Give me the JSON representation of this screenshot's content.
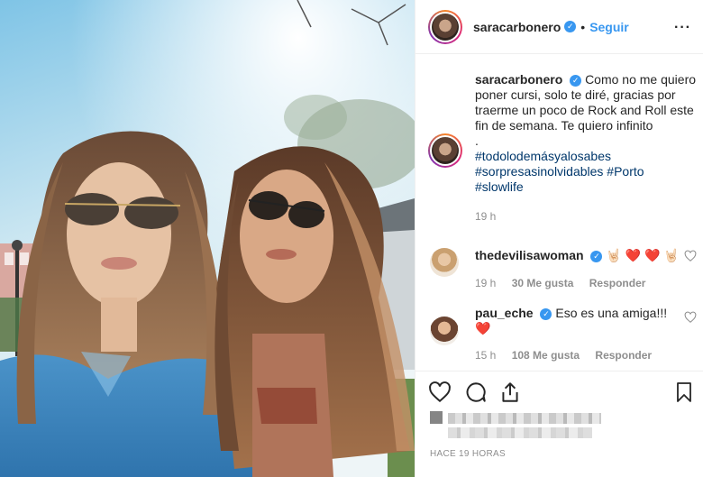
{
  "post": {
    "username": "saracarbonero",
    "follow_label": "Seguir",
    "dot": "•",
    "verified_mark": "✓",
    "more_icon": "more-horizontal-icon"
  },
  "caption": {
    "username": "saracarbonero",
    "text": "Como no me quiero poner cursi, solo te diré, gracias por traerme un poco de Rock and Roll este fin de semana. Te quiero infinito",
    "dot": ".",
    "hashtags_line1": "#todolodemásyalosabes",
    "hashtags_line2": "#sorpresasinolvidables #Porto",
    "hashtags_line3": "#slowlife",
    "time": "19 h"
  },
  "comments": [
    {
      "username": "thedevilisawoman",
      "text": "🤘🏻 ❤️ ❤️ 🤘🏻",
      "time": "19 h",
      "likes": "30 Me gusta",
      "reply_label": "Responder"
    },
    {
      "username": "pau_eche",
      "text": "Eso es una amiga!!!",
      "text2": "❤️",
      "time": "15 h",
      "likes": "108 Me gusta",
      "reply_label": "Responder"
    }
  ],
  "footer": {
    "posted_time": "HACE 19 HORAS"
  },
  "colors": {
    "accent": "#3897f0",
    "hashtag": "#00376b",
    "muted": "#8e8e8e",
    "heart": "#ed4956"
  }
}
